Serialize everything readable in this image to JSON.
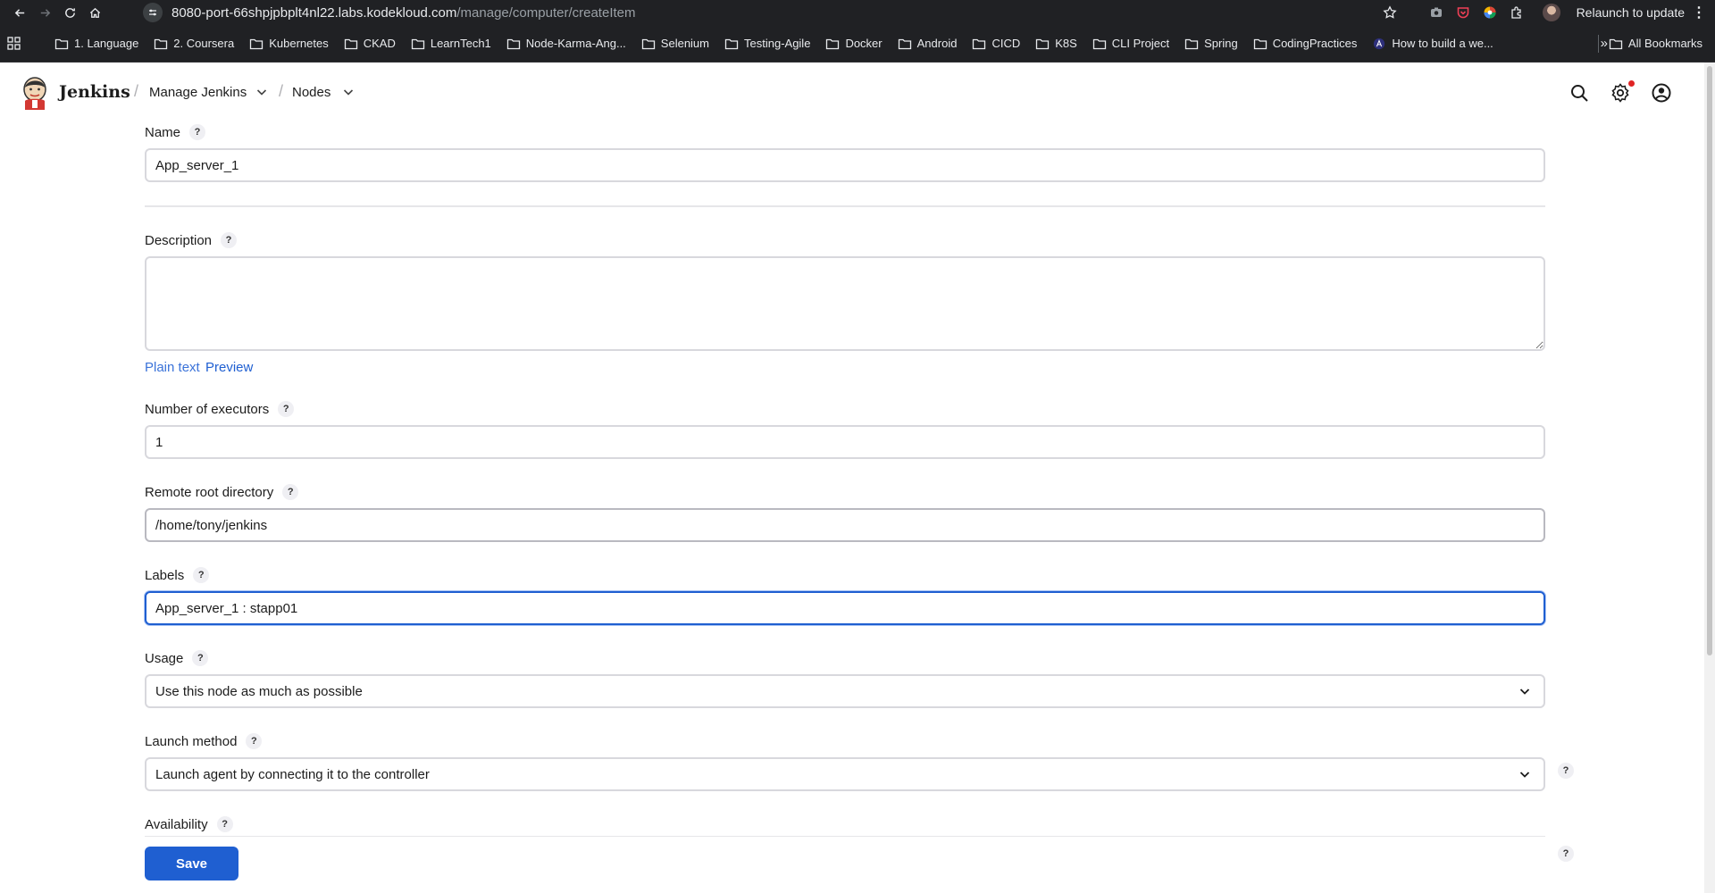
{
  "browser": {
    "url_host": "8080-port-66shpjpbplt4nl22.labs.kodekloud.com",
    "url_path": "/manage/computer/createItem",
    "relaunch_label": "Relaunch to update"
  },
  "bookmarks": {
    "items": [
      {
        "label": "1. Language"
      },
      {
        "label": "2. Coursera"
      },
      {
        "label": "Kubernetes"
      },
      {
        "label": "CKAD"
      },
      {
        "label": "LearnTech1"
      },
      {
        "label": "Node-Karma-Ang..."
      },
      {
        "label": "Selenium"
      },
      {
        "label": "Testing-Agile"
      },
      {
        "label": "Docker"
      },
      {
        "label": "Android"
      },
      {
        "label": "CICD"
      },
      {
        "label": "K8S"
      },
      {
        "label": "CLI Project"
      },
      {
        "label": "Spring"
      },
      {
        "label": "CodingPractices"
      },
      {
        "label": "How to build a we..."
      }
    ],
    "more": "»",
    "all_label": "All Bookmarks"
  },
  "header": {
    "brand": "Jenkins",
    "breadcrumbs": [
      "Manage Jenkins",
      "Nodes"
    ]
  },
  "form": {
    "name": {
      "label": "Name",
      "value": "App_server_1"
    },
    "description": {
      "label": "Description",
      "value": "",
      "plain_text": "Plain text",
      "preview": "Preview"
    },
    "executors": {
      "label": "Number of executors",
      "value": "1"
    },
    "remote_root": {
      "label": "Remote root directory",
      "value": "/home/tony/jenkins"
    },
    "labels": {
      "label": "Labels",
      "value": "App_server_1 : stapp01"
    },
    "usage": {
      "label": "Usage",
      "value": "Use this node as much as possible"
    },
    "launch_method": {
      "label": "Launch method",
      "value": "Launch agent by connecting it to the controller"
    },
    "availability": {
      "label": "Availability"
    },
    "help_mark": "?",
    "save_label": "Save"
  },
  "colors": {
    "accent": "#1f5fd1",
    "notification": "#e02424"
  }
}
